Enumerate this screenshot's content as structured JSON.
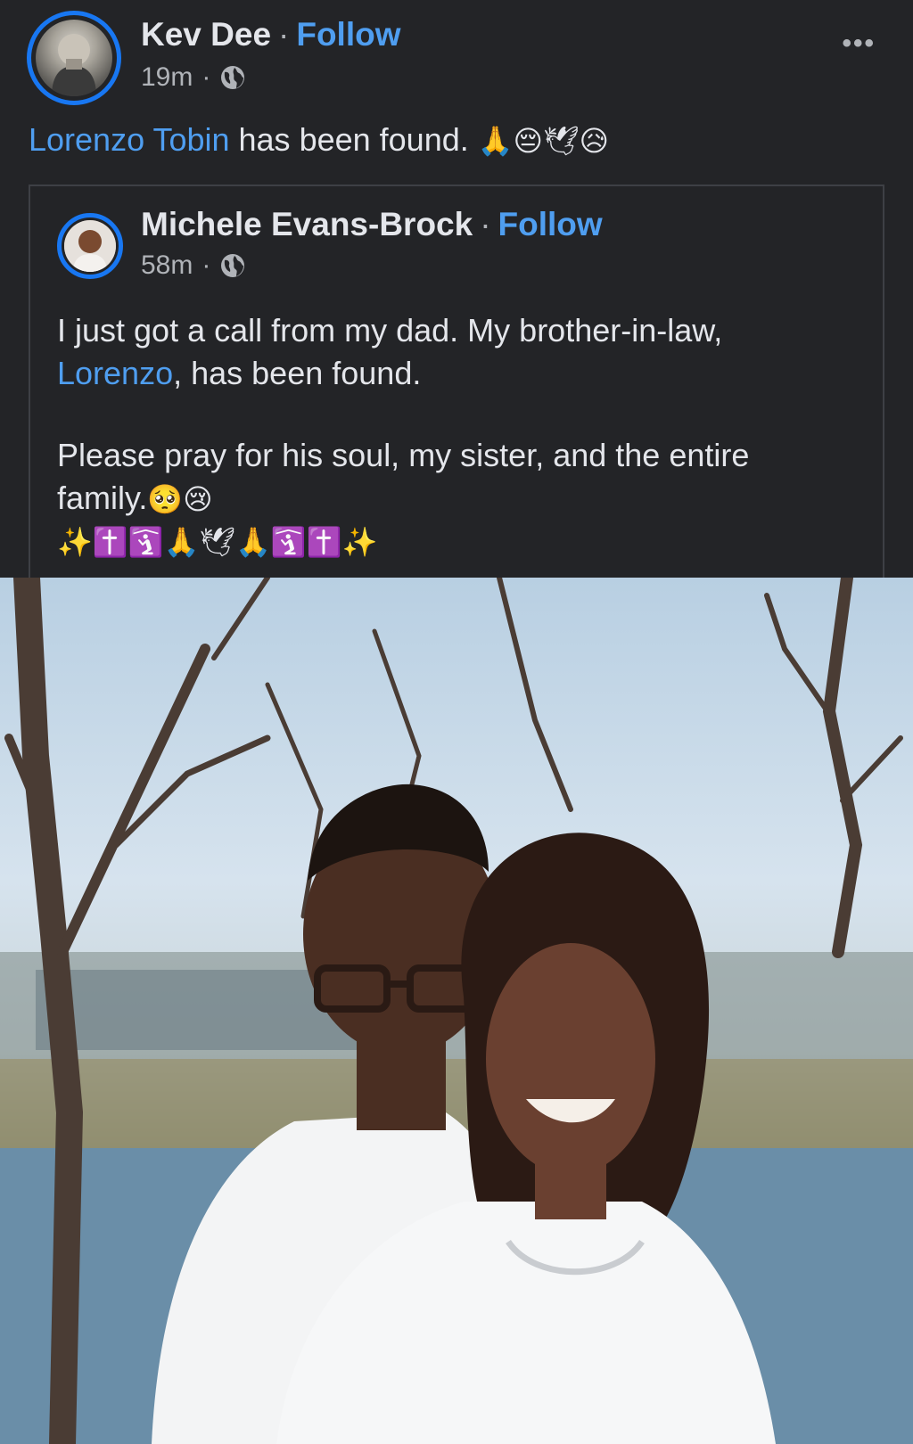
{
  "post": {
    "author": "Kev Dee",
    "separator": "·",
    "follow": "Follow",
    "time": "19m",
    "meta_dot": "·",
    "more": "•••",
    "text_link": "Lorenzo Tobin",
    "text_rest": " has been found.",
    "emojis": "🙏😔🕊😥"
  },
  "shared": {
    "author": "Michele Evans-Brock",
    "separator": "·",
    "follow": "Follow",
    "time": "58m",
    "meta_dot": "·",
    "line1": "I just got a call from my dad. My brother-in-law,",
    "line2_link": "Lorenzo",
    "line2_rest": ", has been found.",
    "para2_line1": "Please pray for his soul, my sister, and the entire",
    "para2_line2": "family.",
    "para2_emojis": "🥺😢",
    "emoji_row": "✨✝️🛐🙏🕊🙏🛐✝️✨"
  },
  "icons": {
    "globe": "globe-icon",
    "more": "more-options-icon"
  },
  "colors": {
    "background": "#232427",
    "link": "#4f9ef0",
    "story_ring": "#1877f2",
    "secondary_text": "#b0b3b8"
  }
}
